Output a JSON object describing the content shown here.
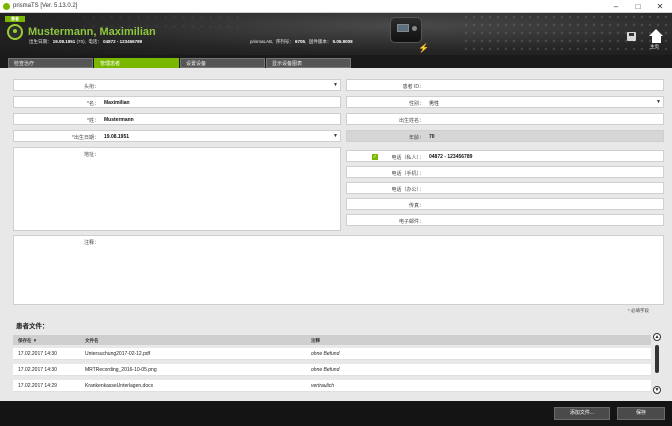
{
  "window": {
    "title": "prismaTS [Ver. 5.13.0.2]",
    "min": "–",
    "max": "□",
    "close": "✕"
  },
  "header": {
    "badge": "患者",
    "patient_name": "Mustermann, Maximilian",
    "dob_label": "出生日期：",
    "dob_value": "19.08.1951",
    "age_value": "(70)",
    "phone_label": "电话：",
    "phone_value": "04872 - 123456789",
    "device_name": "prismaLAB",
    "serial_label": "序列号：",
    "serial_value": "6705",
    "fw_label": "固件版本：",
    "fw_value": "5.05.9008",
    "home_label": "主页"
  },
  "tabs": [
    {
      "label": "检查治疗",
      "active": false
    },
    {
      "label": "管理患者",
      "active": true
    },
    {
      "label": "设置设备",
      "active": false
    },
    {
      "label": "显示设备图表",
      "active": false
    }
  ],
  "form": {
    "title_label": "头衔：",
    "title_value": "",
    "firstname_label": "*名：",
    "firstname_value": "Maximilian",
    "lastname_label": "*姓：",
    "lastname_value": "Mustermann",
    "dob_label": "*出生日期：",
    "dob_value": "19.08.1951",
    "address_label": "地址：",
    "notes_label": "注释：",
    "patient_id_label": "患者 ID：",
    "patient_id_value": "",
    "gender_label": "性别：",
    "gender_value": "男性",
    "birthname_label": "出生姓名：",
    "age_label": "年龄：",
    "age_value": "70",
    "phone_private_label": "电话（私人）：",
    "phone_private_value": "04872 - 123456789",
    "phone_mobile_label": "电话（手机）：",
    "phone_office_label": "电话（办公）：",
    "fax_label": "传真：",
    "email_label": "电子邮件：",
    "required_note": "* 必填字段"
  },
  "files": {
    "title": "患者文件：",
    "columns": [
      "保存在 ▼",
      "文件名",
      "注释"
    ],
    "rows": [
      {
        "date": "17.02.2017 14:30",
        "name": "Untersuchung2017-02-12.pdf",
        "note": "ohne Befund"
      },
      {
        "date": "17.02.2017 14:30",
        "name": "MRTRecording_2016-10-05.png",
        "note": "ohne Befund"
      },
      {
        "date": "17.02.2017 14:29",
        "name": "KrankenkasseUnterlagen.docx",
        "note": "vertraulich"
      }
    ]
  },
  "footer": {
    "add_file": "添加文件...",
    "save": "保存"
  }
}
